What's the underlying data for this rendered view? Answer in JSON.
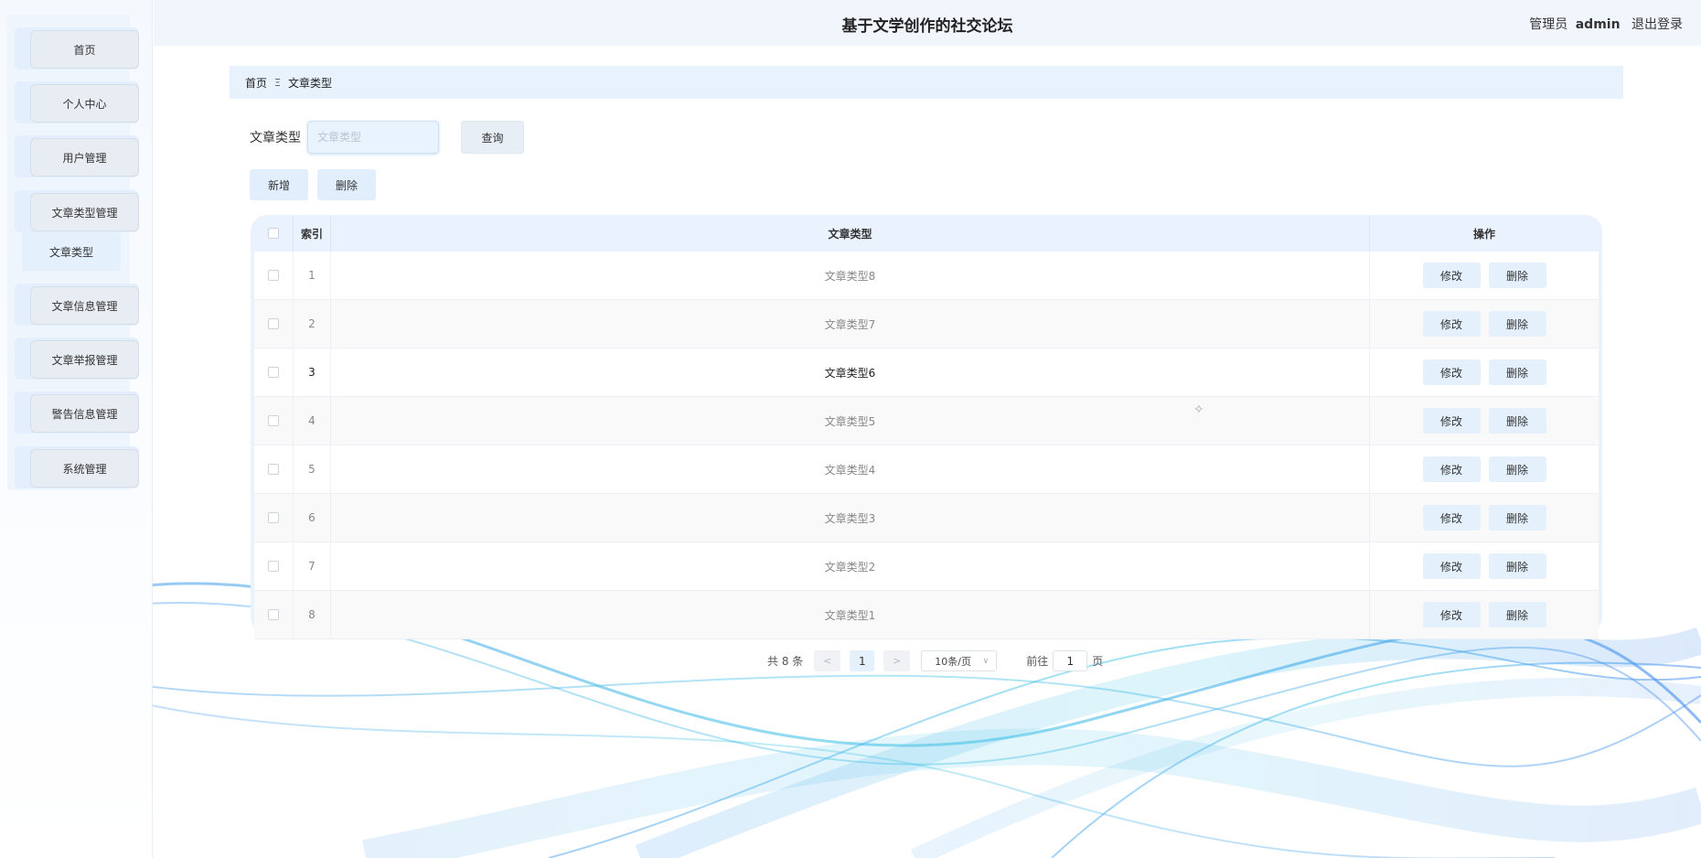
{
  "header": {
    "title": "基于文学创作的社交论坛",
    "role": "管理员",
    "username": "admin",
    "logout": "退出登录"
  },
  "sidebar": {
    "items": [
      {
        "label": "首页"
      },
      {
        "label": "个人中心"
      },
      {
        "label": "用户管理"
      },
      {
        "label": "文章类型管理"
      },
      {
        "label": "文章信息管理"
      },
      {
        "label": "文章举报管理"
      },
      {
        "label": "警告信息管理"
      },
      {
        "label": "系统管理"
      }
    ],
    "submenu": {
      "label": "文章类型"
    }
  },
  "breadcrumb": {
    "home": "首页",
    "current": "文章类型"
  },
  "search": {
    "label": "文章类型",
    "placeholder": "文章类型",
    "query_label": "查询"
  },
  "actions": {
    "add": "新增",
    "delete": "删除"
  },
  "table": {
    "headers": {
      "index": "索引",
      "type": "文章类型",
      "ops": "操作"
    },
    "edit_label": "修改",
    "delete_label": "删除",
    "rows": [
      {
        "index": "1",
        "type": "文章类型8"
      },
      {
        "index": "2",
        "type": "文章类型7"
      },
      {
        "index": "3",
        "type": "文章类型6"
      },
      {
        "index": "4",
        "type": "文章类型5"
      },
      {
        "index": "5",
        "type": "文章类型4"
      },
      {
        "index": "6",
        "type": "文章类型3"
      },
      {
        "index": "7",
        "type": "文章类型2"
      },
      {
        "index": "8",
        "type": "文章类型1"
      }
    ]
  },
  "pagination": {
    "total": "共 8 条",
    "prev": "<",
    "next": ">",
    "current_page": "1",
    "page_size": "10条/页",
    "goto_prefix": "前往",
    "goto_value": "1",
    "goto_suffix": "页"
  },
  "colors": {
    "accent": "#e4f0fc",
    "header_bg": "#f1f6fd",
    "wave": "#3fb4e8"
  },
  "icons": {
    "size_chevron": "chevron-down-icon",
    "breadcrumb_sep": "menu-separator-icon"
  }
}
